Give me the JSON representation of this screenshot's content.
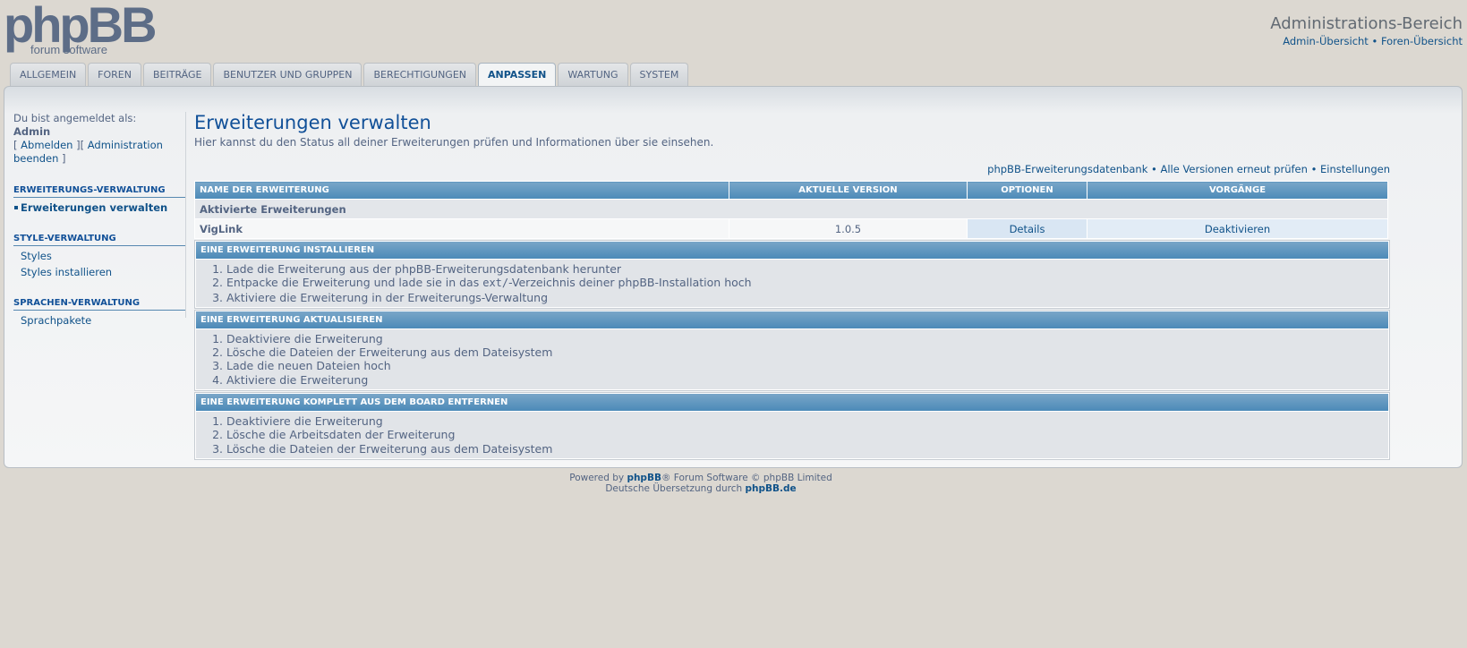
{
  "header": {
    "logo_text": "phpBB",
    "logo_tagline": "forum software",
    "admin_title": "Administrations-Bereich",
    "admin_link": "Admin-Übersicht",
    "forum_link": "Foren-Übersicht",
    "separator": "•"
  },
  "tabs": [
    {
      "label": "ALLGEMEIN"
    },
    {
      "label": "FOREN"
    },
    {
      "label": "BEITRÄGE"
    },
    {
      "label": "BENUTZER UND GRUPPEN"
    },
    {
      "label": "BERECHTIGUNGEN"
    },
    {
      "label": "ANPASSEN",
      "active": true
    },
    {
      "label": "WARTUNG"
    },
    {
      "label": "SYSTEM"
    }
  ],
  "sidebar": {
    "logged_in_label": "Du bist angemeldet als:",
    "username": "Admin",
    "logout_link": "Abmelden",
    "end_admin_link": "Administration beenden",
    "sections": [
      {
        "title": "ERWEITERUNGS-VERWALTUNG",
        "items": [
          {
            "label": "Erweiterungen verwalten"
          }
        ]
      },
      {
        "title": "STYLE-VERWALTUNG",
        "items": [
          {
            "label": "Styles"
          },
          {
            "label": "Styles installieren"
          }
        ]
      },
      {
        "title": "SPRACHEN-VERWALTUNG",
        "items": [
          {
            "label": "Sprachpakete"
          }
        ]
      }
    ]
  },
  "main": {
    "title": "Erweiterungen verwalten",
    "description": "Hier kannst du den Status all deiner Erweiterungen prüfen und Informationen über sie einsehen.",
    "links": {
      "db": "phpBB-Erweiterungsdatenbank",
      "recheck": "Alle Versionen erneut prüfen",
      "settings": "Einstellungen"
    },
    "table": {
      "headers": [
        "NAME DER ERWEITERUNG",
        "AKTUELLE VERSION",
        "OPTIONEN",
        "VORGÄNGE"
      ],
      "section_label": "Aktivierte Erweiterungen",
      "rows": [
        {
          "name": "VigLink",
          "version": "1.0.5",
          "option": "Details",
          "action": "Deaktivieren"
        }
      ]
    },
    "install": {
      "title": "EINE ERWEITERUNG INSTALLIEREN",
      "step1": "Lade die Erweiterung aus der phpBB-Erweiterungsdatenbank herunter",
      "step2_pre": "Entpacke die Erweiterung und lade sie in das",
      "step2_code": "ext/",
      "step2_post": "-Verzeichnis deiner phpBB-Installation hoch",
      "step3": "Aktiviere die Erweiterung in der Erweiterungs-Verwaltung"
    },
    "update": {
      "title": "EINE ERWEITERUNG AKTUALISIEREN",
      "steps": [
        "Deaktiviere die Erweiterung",
        "Lösche die Dateien der Erweiterung aus dem Dateisystem",
        "Lade die neuen Dateien hoch",
        "Aktiviere die Erweiterung"
      ]
    },
    "remove": {
      "title": "EINE ERWEITERUNG KOMPLETT AUS DEM BOARD ENTFERNEN",
      "steps": [
        "Deaktiviere die Erweiterung",
        "Lösche die Arbeitsdaten der Erweiterung",
        "Lösche die Dateien der Erweiterung aus dem Dateisystem"
      ]
    }
  },
  "footer": {
    "powered_pre": "Powered by",
    "powered_link": "phpBB",
    "powered_post": "® Forum Software © phpBB Limited",
    "translation_pre": "Deutsche Übersetzung durch",
    "translation_link": "phpBB.de"
  }
}
